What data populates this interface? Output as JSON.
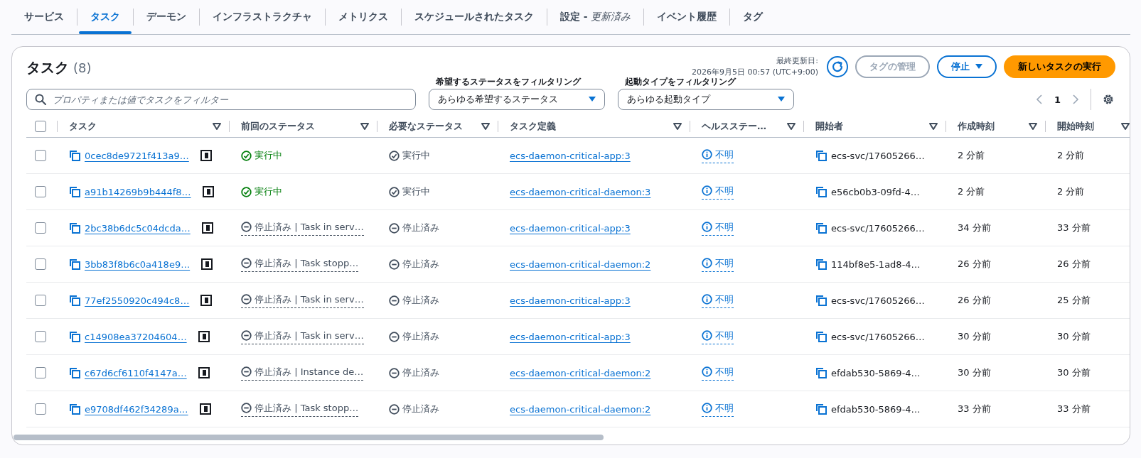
{
  "tabs": [
    {
      "label": "サービス",
      "selected": false
    },
    {
      "label": "タスク",
      "selected": true
    },
    {
      "label": "デーモン",
      "selected": false
    },
    {
      "label": "インフラストラクチャ",
      "selected": false
    },
    {
      "label": "メトリクス",
      "selected": false
    },
    {
      "label": "スケジュールされたタスク",
      "selected": false
    },
    {
      "label": "設定 -",
      "status": "更新済み",
      "selected": false
    },
    {
      "label": "イベント履歴",
      "selected": false
    },
    {
      "label": "タグ",
      "selected": false
    }
  ],
  "panel": {
    "title": "タスク",
    "count": "(8)",
    "last_updated_label": "最終更新日:",
    "last_updated": "2026年9月5日 00:57 (UTC+9:00)",
    "buttons": [
      {
        "kind": "refresh",
        "disabled": false
      },
      {
        "kind": "normal",
        "label": "タグの管理",
        "disabled": true
      },
      {
        "kind": "dropdown",
        "label": "停止",
        "disabled": false
      },
      {
        "kind": "primary",
        "label": "新しいタスクの実行",
        "disabled": false
      }
    ],
    "search": {
      "placeholder": "プロパティまたは値でタスクをフィルター"
    },
    "filters": [
      {
        "label": "希望するステータスをフィルタリング",
        "value": "あらゆる希望するステータス"
      },
      {
        "label": "起動タイプをフィルタリング",
        "value": "あらゆる起動タイプ"
      }
    ],
    "pagination": {
      "page": "1"
    }
  },
  "table": {
    "select_all": {
      "checked": false
    },
    "columns": [
      "タスク",
      "前回のステータス",
      "必要なステータス",
      "タスク定義",
      "ヘルスステー…",
      "開始者",
      "作成時刻",
      "開始時刻"
    ],
    "rows": [
      {
        "checked": false,
        "task": "0cec8de9721f413a9…",
        "last_status": {
          "kind": "running",
          "text": "実行中"
        },
        "desired_status": {
          "kind": "running",
          "text": "実行中"
        },
        "task_definition": "ecs-daemon-critical-app:3",
        "health": "不明",
        "started_by": "ecs-svc/17605266…",
        "created": "2 分前",
        "started": "2 分前"
      },
      {
        "checked": false,
        "task": "a91b14269b9b444f8…",
        "last_status": {
          "kind": "running",
          "text": "実行中"
        },
        "desired_status": {
          "kind": "running",
          "text": "実行中"
        },
        "task_definition": "ecs-daemon-critical-daemon:3",
        "health": "不明",
        "started_by": "e56cb0b3-09fd-4…",
        "created": "2 分前",
        "started": "2 分前"
      },
      {
        "checked": false,
        "task": "2bc38b6dc5c04dcda…",
        "last_status": {
          "kind": "stopped",
          "text": "停止済み | Task in serv…"
        },
        "desired_status": {
          "kind": "stopped",
          "text": "停止済み"
        },
        "task_definition": "ecs-daemon-critical-app:3",
        "health": "不明",
        "started_by": "ecs-svc/17605266…",
        "created": "34 分前",
        "started": "33 分前"
      },
      {
        "checked": false,
        "task": "3bb83f8b6c0a418e9…",
        "last_status": {
          "kind": "stopped",
          "text": "停止済み | Task stopp…"
        },
        "desired_status": {
          "kind": "stopped",
          "text": "停止済み"
        },
        "task_definition": "ecs-daemon-critical-daemon:2",
        "health": "不明",
        "started_by": "114bf8e5-1ad8-4…",
        "created": "26 分前",
        "started": "26 分前"
      },
      {
        "checked": false,
        "task": "77ef2550920c494c8…",
        "last_status": {
          "kind": "stopped",
          "text": "停止済み | Task in serv…"
        },
        "desired_status": {
          "kind": "stopped",
          "text": "停止済み"
        },
        "task_definition": "ecs-daemon-critical-app:3",
        "health": "不明",
        "started_by": "ecs-svc/17605266…",
        "created": "26 分前",
        "started": "25 分前"
      },
      {
        "checked": false,
        "task": "c14908ea37204604…",
        "last_status": {
          "kind": "stopped",
          "text": "停止済み | Task in serv…"
        },
        "desired_status": {
          "kind": "stopped",
          "text": "停止済み"
        },
        "task_definition": "ecs-daemon-critical-app:3",
        "health": "不明",
        "started_by": "ecs-svc/17605266…",
        "created": "30 分前",
        "started": "30 分前"
      },
      {
        "checked": false,
        "task": "c67d6cf6110f4147a…",
        "last_status": {
          "kind": "stopped",
          "text": "停止済み | Instance de…"
        },
        "desired_status": {
          "kind": "stopped",
          "text": "停止済み"
        },
        "task_definition": "ecs-daemon-critical-daemon:2",
        "health": "不明",
        "started_by": "efdab530-5869-4…",
        "created": "30 分前",
        "started": "30 分前"
      },
      {
        "checked": false,
        "task": "e9708df462f34289a…",
        "last_status": {
          "kind": "stopped",
          "text": "停止済み | Task stopp…"
        },
        "desired_status": {
          "kind": "stopped",
          "text": "停止済み"
        },
        "task_definition": "ecs-daemon-critical-daemon:2",
        "health": "不明",
        "started_by": "efdab530-5869-4…",
        "created": "33 分前",
        "started": "33 分前"
      }
    ]
  }
}
